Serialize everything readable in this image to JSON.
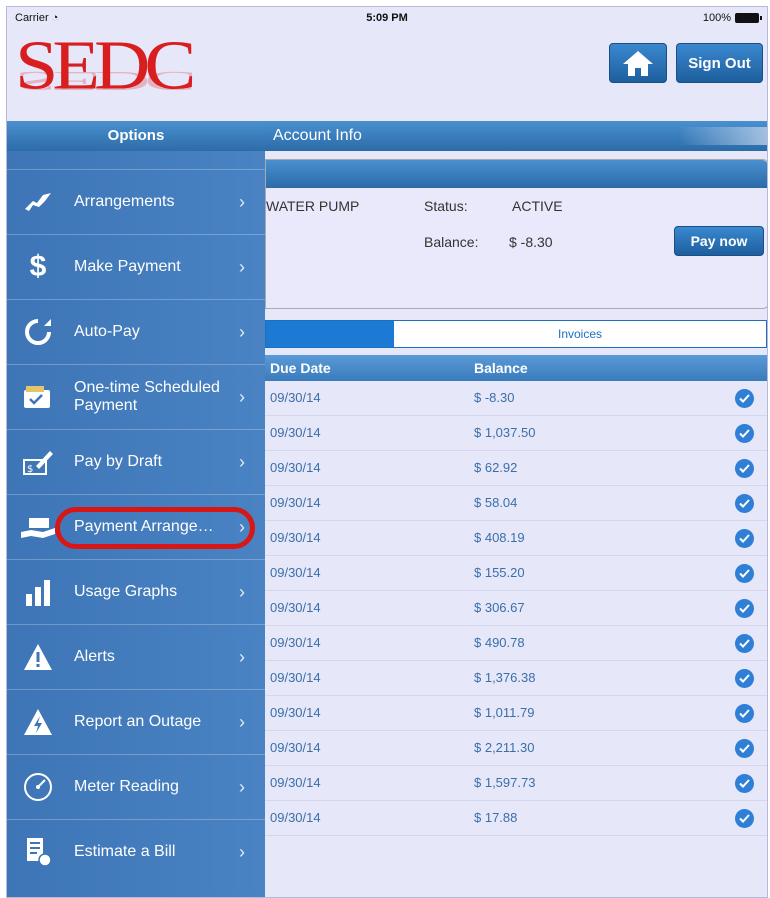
{
  "status_bar": {
    "carrier": "Carrier",
    "time": "5:09 PM",
    "battery": "100%"
  },
  "header": {
    "logo_text": "SEDC",
    "sign_out_label": "Sign Out"
  },
  "account_bar": {
    "title": "Account Info"
  },
  "account": {
    "name": "WATER PUMP",
    "status_label": "Status:",
    "status_value": "ACTIVE",
    "balance_label": "Balance:",
    "balance_value": "$ -8.30",
    "pay_now_label": "Pay now"
  },
  "segments": {
    "invoices_label": "Invoices"
  },
  "table": {
    "headers": {
      "due_date": "Due Date",
      "balance": "Balance"
    },
    "rows": [
      {
        "due_date": "09/30/14",
        "balance": "$ -8.30"
      },
      {
        "due_date": "09/30/14",
        "balance": "$ 1,037.50"
      },
      {
        "due_date": "09/30/14",
        "balance": "$ 62.92"
      },
      {
        "due_date": "09/30/14",
        "balance": "$ 58.04"
      },
      {
        "due_date": "09/30/14",
        "balance": "$ 408.19"
      },
      {
        "due_date": "09/30/14",
        "balance": "$ 155.20"
      },
      {
        "due_date": "09/30/14",
        "balance": "$ 306.67"
      },
      {
        "due_date": "09/30/14",
        "balance": "$ 490.78"
      },
      {
        "due_date": "09/30/14",
        "balance": "$ 1,376.38"
      },
      {
        "due_date": "09/30/14",
        "balance": "$ 1,011.79"
      },
      {
        "due_date": "09/30/14",
        "balance": "$ 2,211.30"
      },
      {
        "due_date": "09/30/14",
        "balance": "$ 1,597.73"
      },
      {
        "due_date": "09/30/14",
        "balance": "$ 17.88"
      }
    ]
  },
  "sidebar": {
    "title": "Options",
    "items": [
      {
        "label": "Arrangements",
        "icon": "handshake-icon"
      },
      {
        "label": "Make Payment",
        "icon": "dollar-icon"
      },
      {
        "label": "Auto-Pay",
        "icon": "refresh-icon"
      },
      {
        "label": "One-time Scheduled Payment",
        "icon": "wallet-icon"
      },
      {
        "label": "Pay by Draft",
        "icon": "check-sign-icon"
      },
      {
        "label": "Payment Arrange…",
        "icon": "hand-cash-icon"
      },
      {
        "label": "Usage Graphs",
        "icon": "bar-graph-icon"
      },
      {
        "label": "Alerts",
        "icon": "warning-icon"
      },
      {
        "label": "Report an Outage",
        "icon": "lightning-icon"
      },
      {
        "label": "Meter Reading",
        "icon": "gauge-icon"
      },
      {
        "label": "Estimate a Bill",
        "icon": "bill-icon"
      }
    ]
  },
  "colors": {
    "brand_red": "#d81e1e",
    "accent_blue": "#2f7fd6",
    "sidebar_blue": "#4a83c3",
    "highlight_red": "#d91616"
  }
}
